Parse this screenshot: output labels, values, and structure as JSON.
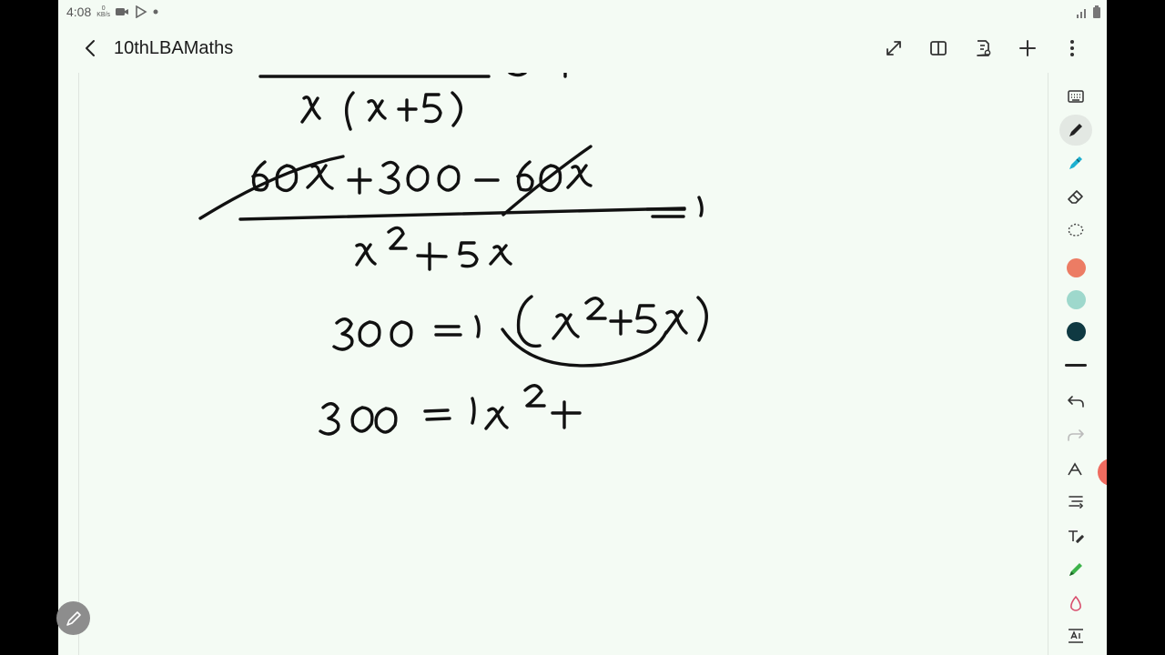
{
  "status": {
    "time": "4:08",
    "net_top": "0",
    "net_unit": "KB/s"
  },
  "app_bar": {
    "title": "10thLBAMaths"
  },
  "toolbar": {
    "colors": [
      "#ec7c64",
      "#9ed8cc",
      "#0f3942"
    ]
  }
}
